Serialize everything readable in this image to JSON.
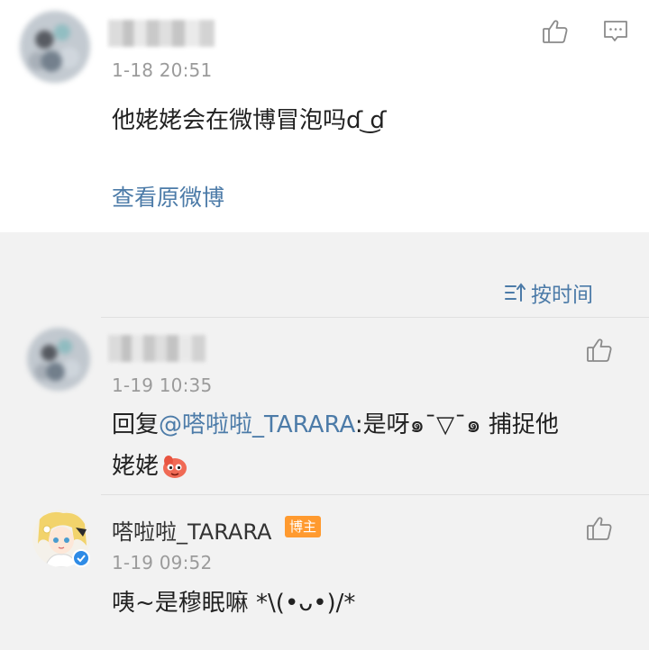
{
  "original_comment": {
    "timestamp": "1-18 20:51",
    "text": "他姥姥会在微博冒泡吗ɗ ͜ɗ",
    "view_original_label": "查看原微博"
  },
  "sort": {
    "label": "按时间"
  },
  "replies": [
    {
      "timestamp": "1-19 10:35",
      "text_prefix": "回复",
      "mention": "@嗒啦啦_TARARA",
      "text_line1": ":是呀๑¯▽¯๑ 捕捉他",
      "text_line2": "姥姥"
    },
    {
      "name": "嗒啦啦_TARARA",
      "badge": "博主",
      "timestamp": "1-19 09:52",
      "text": "咦~是穆眠嘛 *\\(•ᴗ•)/*"
    }
  ],
  "colors": {
    "link": "#4c7ba8",
    "badge": "#ff9a2f",
    "verify": "#2e8be6",
    "card_bg": "#ffffff",
    "list_bg": "#f2f2f2"
  }
}
